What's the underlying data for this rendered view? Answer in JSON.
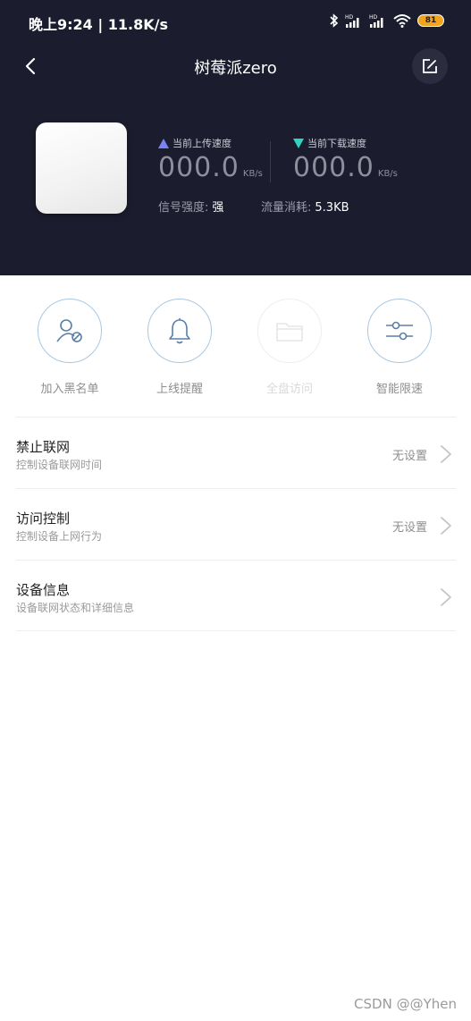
{
  "status_bar": {
    "time": "晚上9:24 | 11.8K/s",
    "battery": "81",
    "icons": [
      "bluetooth-icon",
      "signal-hd-icon",
      "signal-hd-icon",
      "wifi-icon",
      "battery-icon"
    ]
  },
  "nav": {
    "title": "树莓派zero",
    "back_icon": "chevron-left-icon",
    "edit_icon": "edit-icon"
  },
  "device": {
    "upload": {
      "label": "当前上传速度",
      "value": "000.0",
      "unit": "KB/s",
      "color": "#7a82f5"
    },
    "download": {
      "label": "当前下载速度",
      "value": "000.0",
      "unit": "KB/s",
      "color": "#2fd3c1"
    },
    "signal": {
      "label": "信号强度:",
      "value": "强"
    },
    "traffic": {
      "label": "流量消耗:",
      "value": "5.3KB"
    }
  },
  "actions": [
    {
      "label": "加入黑名单",
      "icon": "user-block-icon",
      "enabled": true
    },
    {
      "label": "上线提醒",
      "icon": "bell-icon",
      "enabled": true
    },
    {
      "label": "全盘访问",
      "icon": "folder-icon",
      "enabled": false
    },
    {
      "label": "智能限速",
      "icon": "sliders-icon",
      "enabled": true
    }
  ],
  "menu": [
    {
      "title": "禁止联网",
      "subtitle": "控制设备联网时间",
      "value": "无设置"
    },
    {
      "title": "访问控制",
      "subtitle": "控制设备上网行为",
      "value": "无设置"
    },
    {
      "title": "设备信息",
      "subtitle": "设备联网状态和详细信息",
      "value": ""
    }
  ],
  "watermark": "CSDN @@Yhen",
  "colors": {
    "header_bg": "#1b1d2e",
    "accent_ring": "#a9c8e4",
    "battery": "#f3a41a"
  }
}
